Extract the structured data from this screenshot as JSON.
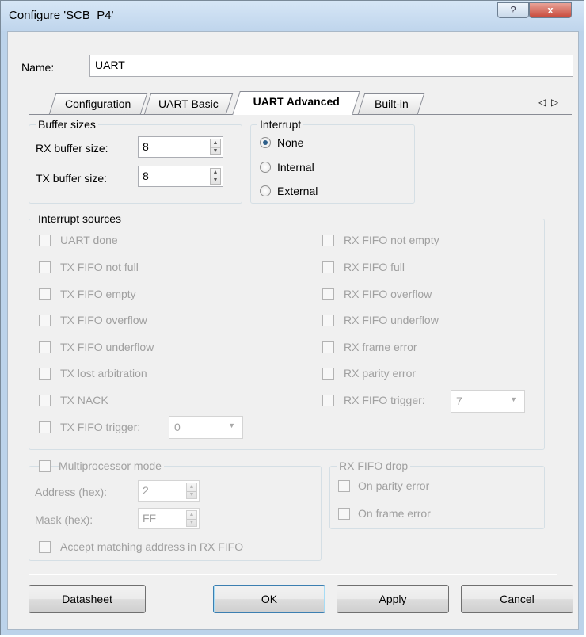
{
  "window": {
    "title": "Configure 'SCB_P4'",
    "help_label": "?",
    "close_label": "x"
  },
  "name_field": {
    "label": "Name:",
    "value": "UART"
  },
  "tabs": [
    {
      "label": "Configuration"
    },
    {
      "label": "UART Basic"
    },
    {
      "label": "UART Advanced"
    },
    {
      "label": "Built-in"
    }
  ],
  "active_tab": "UART Advanced",
  "tab_scroll": {
    "left": "◁",
    "right": "▷"
  },
  "buffer_sizes": {
    "title": "Buffer sizes",
    "rx_label": "RX buffer size:",
    "rx_value": "8",
    "tx_label": "TX buffer size:",
    "tx_value": "8"
  },
  "interrupt": {
    "title": "Interrupt",
    "options": [
      {
        "label": "None",
        "selected": true
      },
      {
        "label": "Internal",
        "selected": false
      },
      {
        "label": "External",
        "selected": false
      }
    ]
  },
  "interrupt_sources": {
    "title": "Interrupt sources",
    "left": [
      "UART done",
      "TX FIFO not full",
      "TX FIFO empty",
      "TX FIFO overflow",
      "TX FIFO underflow",
      "TX lost arbitration",
      "TX NACK",
      "TX FIFO trigger:"
    ],
    "right": [
      "RX FIFO not empty",
      "RX FIFO full",
      "RX FIFO overflow",
      "RX FIFO underflow",
      "RX frame error",
      "RX parity error",
      "RX FIFO trigger:"
    ],
    "tx_trigger_value": "0",
    "rx_trigger_value": "7"
  },
  "multiprocessor": {
    "label": "Multiprocessor mode",
    "address_label": "Address (hex):",
    "address_value": "2",
    "mask_label": "Mask (hex):",
    "mask_value": "FF",
    "accept_label": "Accept matching address in RX FIFO"
  },
  "rx_fifo_drop": {
    "title": "RX FIFO drop",
    "parity_label": "On parity error",
    "frame_label": "On frame error"
  },
  "buttons": {
    "datasheet": "Datasheet",
    "ok": "OK",
    "apply": "Apply",
    "cancel": "Cancel"
  }
}
